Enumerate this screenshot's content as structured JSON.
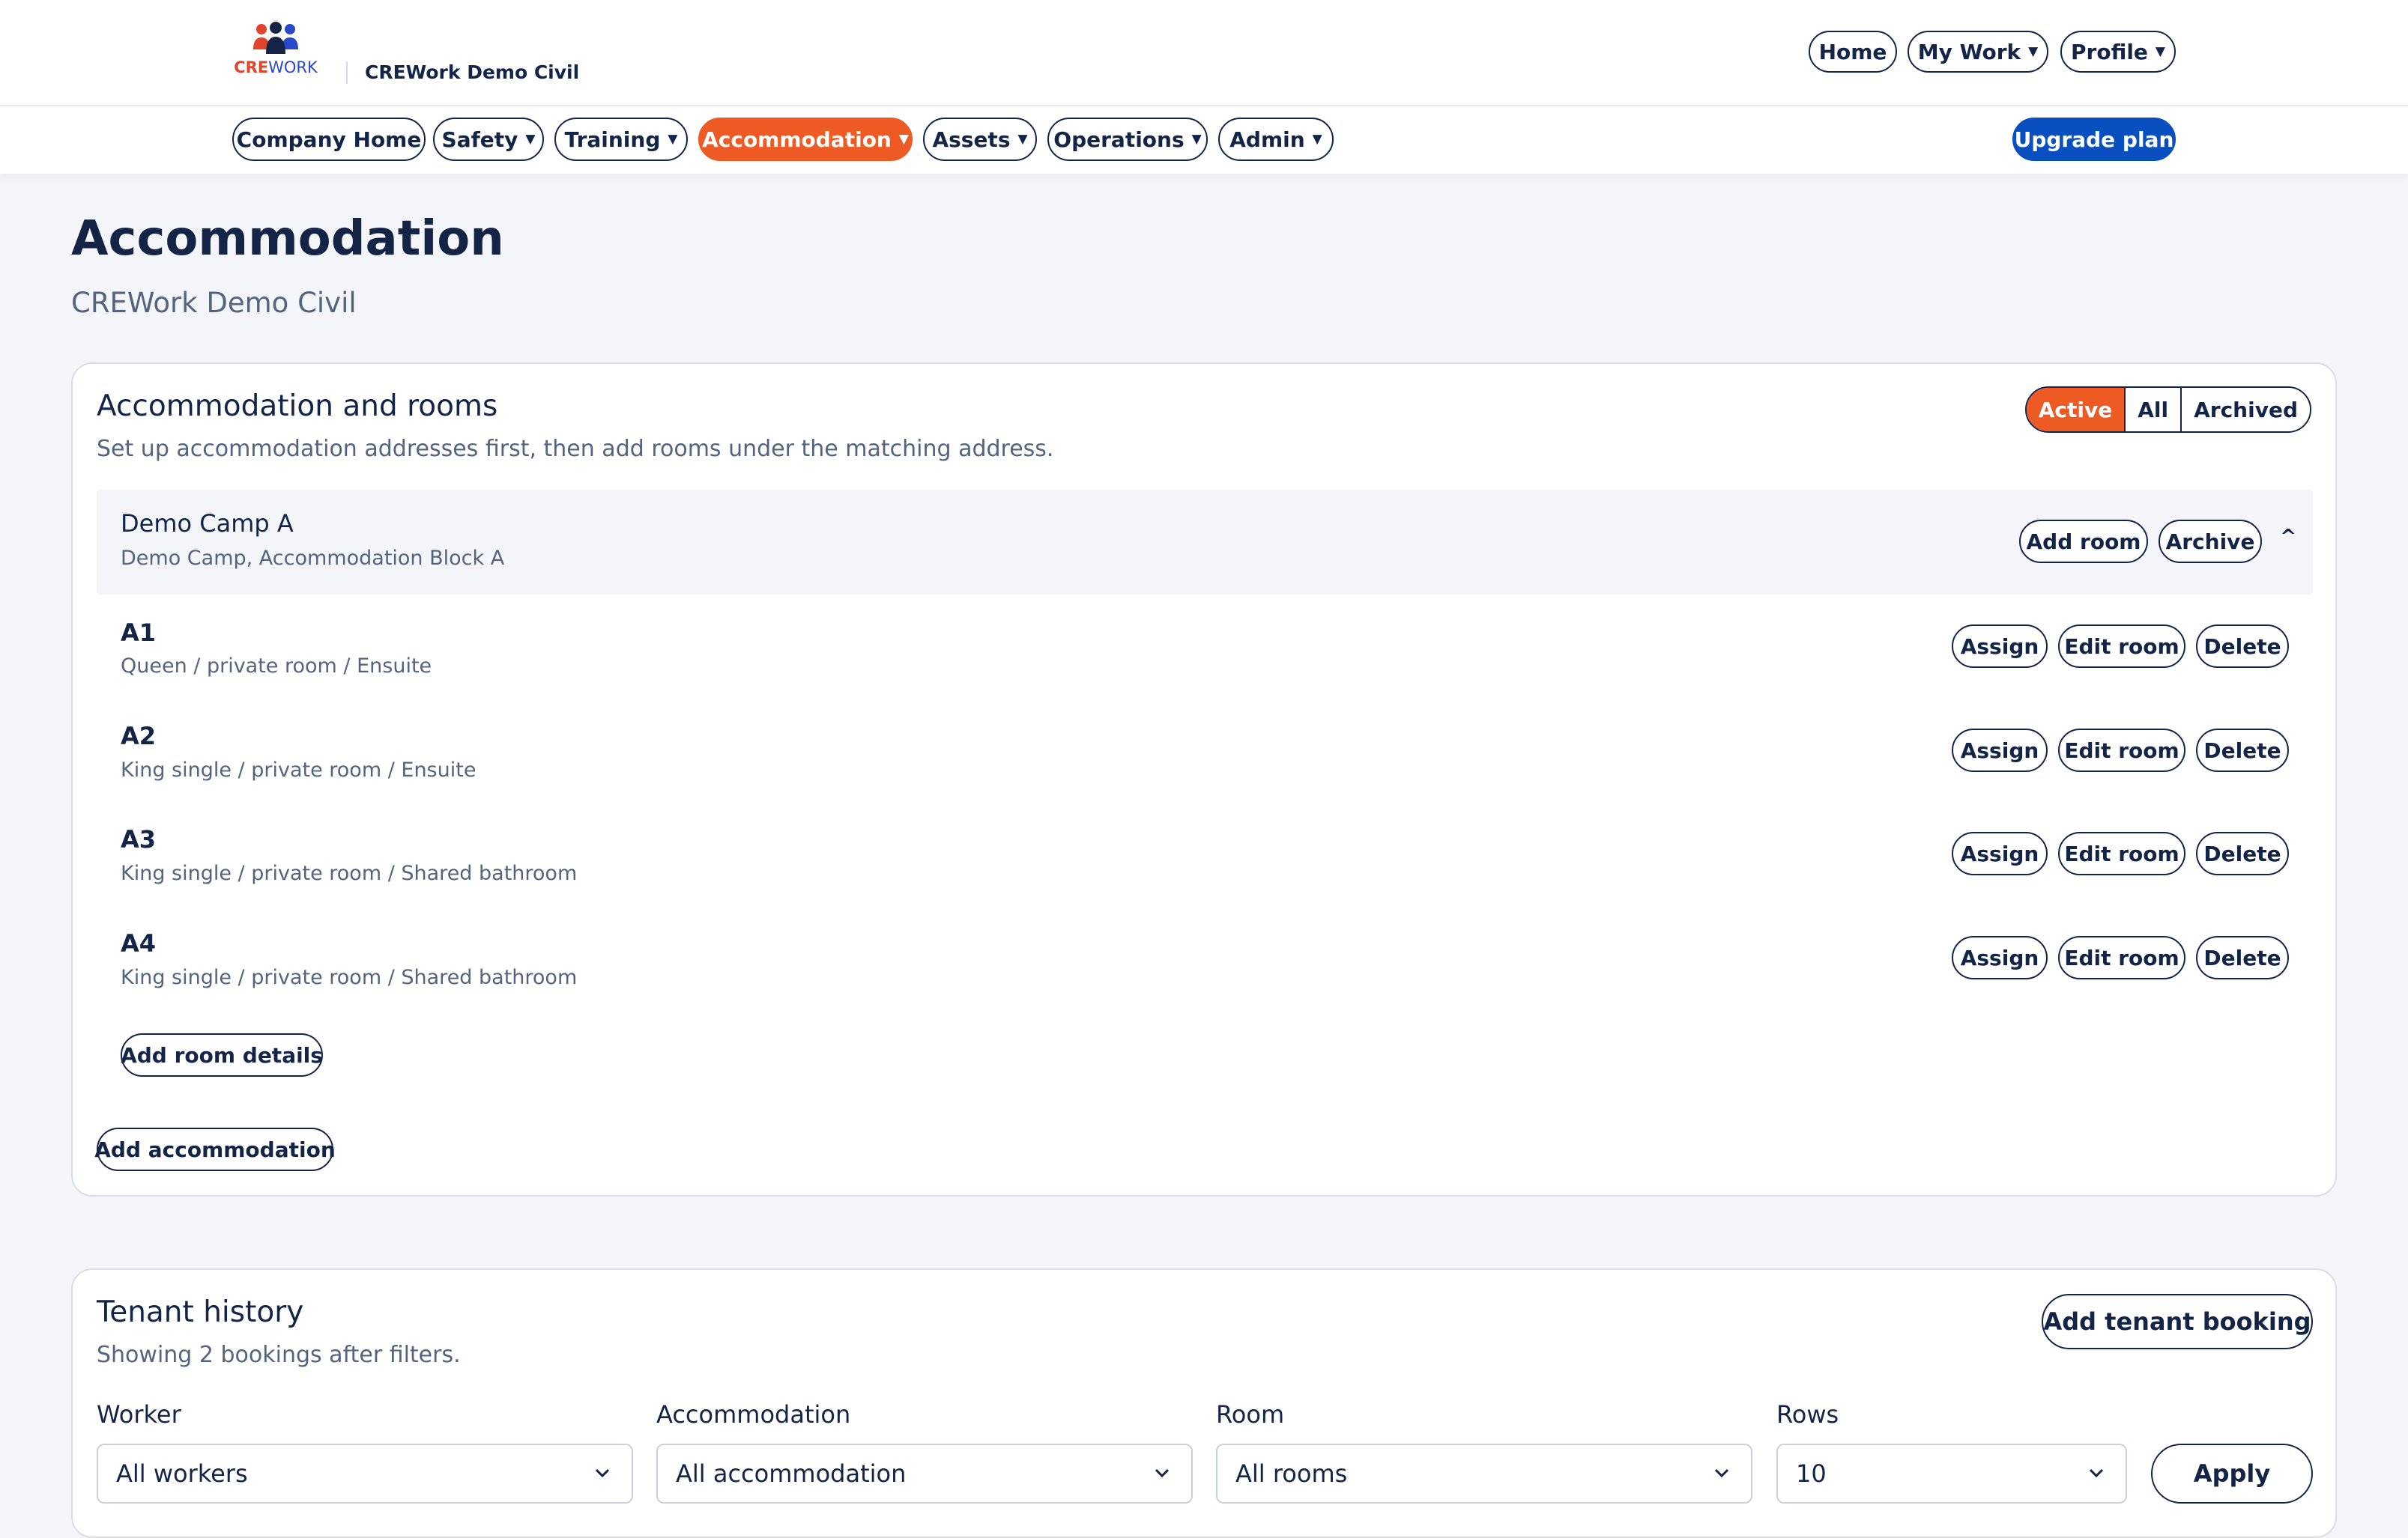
{
  "brand": {
    "logo_prefix": "CRE",
    "logo_suffix": "WORK",
    "company_name": "CREWork Demo Civil",
    "colors": {
      "accent": "#ee5a23",
      "navy": "#142447",
      "primary": "#0a4fbf"
    }
  },
  "top_nav": {
    "home": "Home",
    "my_work": "My Work",
    "profile": "Profile"
  },
  "main_nav": {
    "company_home": "Company Home",
    "safety": "Safety",
    "training": "Training",
    "accommodation": "Accommodation",
    "assets": "Assets",
    "operations": "Operations",
    "admin": "Admin",
    "upgrade": "Upgrade plan"
  },
  "page": {
    "title": "Accommodation",
    "subtitle": "CREWork Demo Civil"
  },
  "accommodation_card": {
    "title": "Accommodation and rooms",
    "description": "Set up accommodation addresses first, then add rooms under the matching address.",
    "filter": {
      "active": "Active",
      "all": "All",
      "archived": "Archived",
      "selected": "Active"
    },
    "group": {
      "name": "Demo Camp A",
      "address": "Demo Camp, Accommodation Block A",
      "add_room": "Add room",
      "archive": "Archive",
      "collapse_icon": "^"
    },
    "rooms": [
      {
        "code": "A1",
        "details": "Queen / private room / Ensuite"
      },
      {
        "code": "A2",
        "details": "King single / private room / Ensuite"
      },
      {
        "code": "A3",
        "details": "King single / private room / Shared bathroom"
      },
      {
        "code": "A4",
        "details": "King single / private room / Shared bathroom"
      }
    ],
    "room_actions": {
      "assign": "Assign",
      "edit": "Edit room",
      "delete": "Delete"
    },
    "add_room_details": "Add room details",
    "add_accommodation": "Add accommodation"
  },
  "tenant_card": {
    "title": "Tenant history",
    "summary": "Showing 2 bookings after filters.",
    "add_booking": "Add tenant booking",
    "filters": {
      "worker": {
        "label": "Worker",
        "value": "All workers"
      },
      "accommodation": {
        "label": "Accommodation",
        "value": "All accommodation"
      },
      "room": {
        "label": "Room",
        "value": "All rooms"
      },
      "rows": {
        "label": "Rows",
        "value": "10"
      }
    },
    "apply": "Apply"
  }
}
